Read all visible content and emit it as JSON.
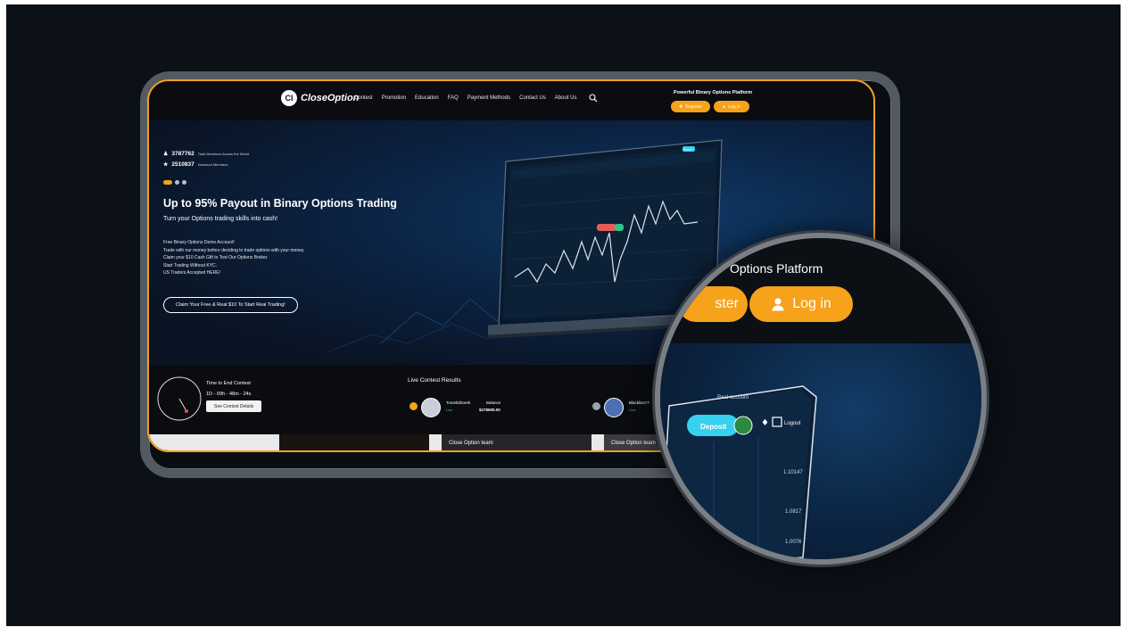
{
  "nav": {
    "logo_badge": "CI",
    "logo_text": "CloseOption",
    "links": [
      "Contest",
      "Promotion",
      "Education",
      "FAQ",
      "Payment Methods",
      "Contact Us",
      "About Us"
    ],
    "tagline": "Powerful Binary Options Platform",
    "register_label": "Register",
    "login_label": "Log in"
  },
  "hero": {
    "members_count": "3787762",
    "members_caption": "Total Members Across the World",
    "diamond_count": "2510837",
    "diamond_caption": "Diamond Members",
    "headline": "Up to 95% Payout in Binary Options Trading",
    "subhead": "Turn your Options trading skills into cash!",
    "bullets": [
      "Free Binary Options Demo Account!",
      "Trade with our money before deciding to trade options with your money.",
      "Claim your $10 Cash Gift to Test Our Options Broker.",
      "Start Trading Without KYC.",
      "US Traders Accepted HERE!"
    ],
    "claim_button": "Claim Your Free & Real $10 To Start Real Trading!"
  },
  "contest": {
    "time_label": "Time to End Contest",
    "countdown": "1D - 09h - 48m - 24s",
    "details_button": "See Contest Details",
    "live_title": "Live Contest Results",
    "trader1_name": "TomekZborek",
    "trader1_status": "Live",
    "balance_label": "Balance",
    "trader1_balance": "$278600.00",
    "trader2_name": "Blacklion77",
    "trader2_status": "Live"
  },
  "cards": {
    "card2_label": "Close Option team",
    "card3_label": "Close Option team"
  },
  "laptop": {
    "deposit": "Deposit"
  },
  "magnifier": {
    "tagline_fragment": "Options Platform",
    "register_fragment": "ster",
    "login_label": "Log in",
    "real_account": "Real account",
    "deposit": "Deposit",
    "logout": "Logout",
    "price1": "1.10147",
    "price2": "1.0817",
    "price3": "1.0076"
  },
  "colors": {
    "accent": "#f7a21b",
    "background": "#0c1017",
    "frame": "#545a62",
    "chart_cyan": "#36d0f0"
  }
}
